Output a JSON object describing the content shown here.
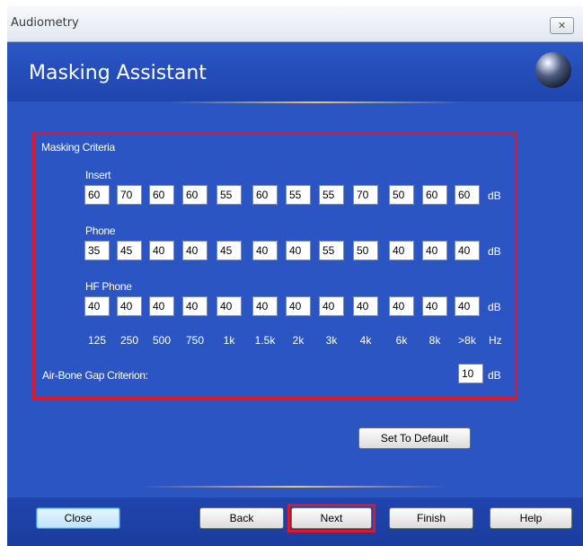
{
  "window": {
    "title": "Audiometry",
    "close_glyph": "✕"
  },
  "header": {
    "title": "Masking Assistant"
  },
  "criteria": {
    "section_title": "Masking Criteria",
    "unit": "dB",
    "rows": [
      {
        "label": "Insert",
        "values": [
          "60",
          "70",
          "60",
          "60",
          "55",
          "60",
          "55",
          "55",
          "70",
          "50",
          "60",
          "60"
        ]
      },
      {
        "label": "Phone",
        "values": [
          "35",
          "45",
          "40",
          "40",
          "45",
          "40",
          "40",
          "55",
          "50",
          "40",
          "40",
          "40"
        ]
      },
      {
        "label": "HF Phone",
        "values": [
          "40",
          "40",
          "40",
          "40",
          "40",
          "40",
          "40",
          "40",
          "40",
          "40",
          "40",
          "40"
        ]
      }
    ],
    "frequencies": [
      "125",
      "250",
      "500",
      "750",
      "1k",
      "1.5k",
      "2k",
      "3k",
      "4k",
      "6k",
      "8k",
      ">8k"
    ],
    "freq_unit": "Hz",
    "air_bone": {
      "label": "Air-Bone Gap Criterion:",
      "value": "10",
      "unit": "dB"
    }
  },
  "buttons": {
    "set_default": "Set To Default",
    "close": "Close",
    "back": "Back",
    "next": "Next",
    "finish": "Finish",
    "help": "Help"
  },
  "colors": {
    "accent_highlight": "#e0172a",
    "panel_bg": "#2a55c3"
  }
}
